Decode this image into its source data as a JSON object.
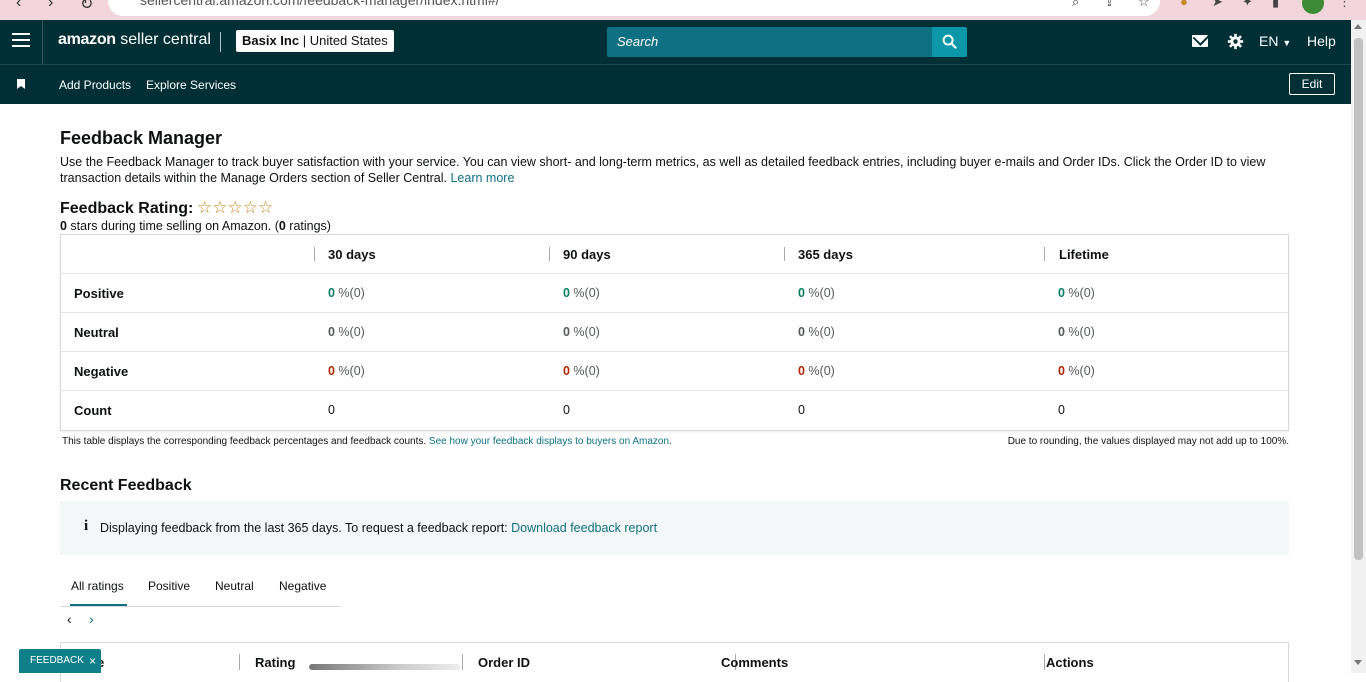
{
  "browser": {
    "url": "sellercentral.amazon.com/feedback-manager/index.html#/"
  },
  "header": {
    "logo_brand": "amazon",
    "logo_product": "seller central",
    "account_name": "Basix Inc",
    "account_region": "United States",
    "search_placeholder": "Search",
    "language": "EN",
    "help_label": "Help"
  },
  "subnav": {
    "links": [
      "Add Products",
      "Explore Services"
    ],
    "edit_label": "Edit"
  },
  "page": {
    "title": "Feedback Manager",
    "description": "Use the Feedback Manager to track buyer satisfaction with your service. You can view short- and long-term metrics, as well as detailed feedback entries, including buyer e-mails and Order IDs. Click the Order ID to view transaction details within the Manage Orders section of Seller Central. ",
    "learn_more": "Learn more"
  },
  "rating": {
    "title": "Feedback Rating:",
    "stars": "☆☆☆☆☆",
    "stars_value": "0",
    "stars_text": " stars during time selling on Amazon. (",
    "ratings_count": "0",
    "ratings_text": " ratings)"
  },
  "feedback_table": {
    "columns": [
      "30 days",
      "90 days",
      "365 days",
      "Lifetime"
    ],
    "rows": [
      {
        "label": "Positive",
        "values": [
          "0",
          "0",
          "0",
          "0"
        ],
        "suffix": " %(0)"
      },
      {
        "label": "Neutral",
        "values": [
          "0",
          "0",
          "0",
          "0"
        ],
        "suffix": " %(0)"
      },
      {
        "label": "Negative",
        "values": [
          "0",
          "0",
          "0",
          "0"
        ],
        "suffix": " %(0)"
      },
      {
        "label": "Count",
        "values": [
          "0",
          "0",
          "0",
          "0"
        ],
        "suffix": ""
      }
    ],
    "note": "This table displays the corresponding feedback percentages and feedback counts. ",
    "note_link": "See how your feedback displays to buyers on Amazon.",
    "note_right": "Due to rounding, the values displayed may not add up to 100%."
  },
  "recent": {
    "title": "Recent Feedback",
    "info_icon": "i",
    "info_text": "Displaying feedback from the last 365 days. To request a feedback report: ",
    "info_link": "Download feedback report",
    "tabs": [
      "All ratings",
      "Positive",
      "Neutral",
      "Negative"
    ],
    "active_tab": "All ratings",
    "list_columns": [
      "e",
      "Rating",
      "Order ID",
      "Comments",
      "Actions"
    ]
  },
  "feedback_widget": {
    "label": "FEEDBACK",
    "close": "×"
  },
  "colors": {
    "header_bg": "#002f36",
    "accent": "#0f7083",
    "positive": "#067d62",
    "negative": "#b12704",
    "star": "#c48a1d"
  }
}
